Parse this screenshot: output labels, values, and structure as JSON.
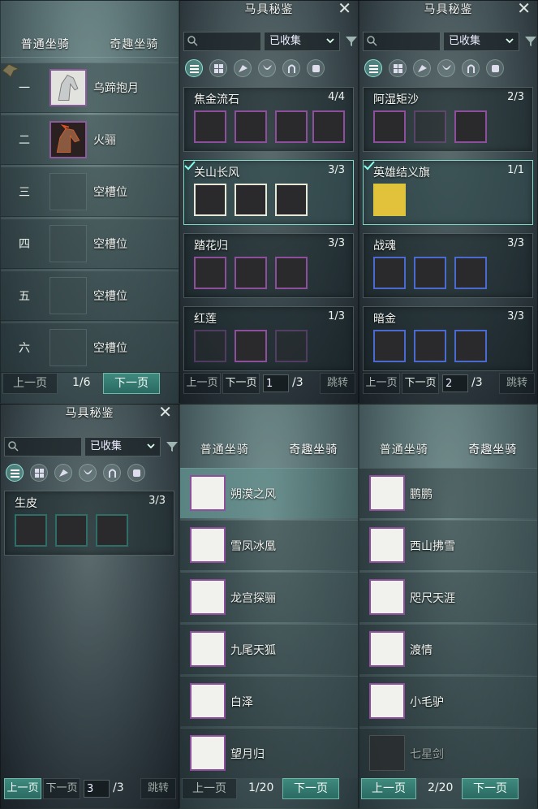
{
  "panel1": {
    "tabs": [
      "普通坐骑",
      "奇趣坐骑"
    ],
    "slots": [
      {
        "num": "一",
        "name": "乌蹄抱月"
      },
      {
        "num": "二",
        "name": "火骊"
      },
      {
        "num": "三",
        "name": "空槽位"
      },
      {
        "num": "四",
        "name": "空槽位"
      },
      {
        "num": "五",
        "name": "空槽位"
      },
      {
        "num": "六",
        "name": "空槽位"
      }
    ],
    "pager": {
      "prev": "上一页",
      "page": "1/6",
      "next": "下一页"
    }
  },
  "panel2": {
    "title": "马具秘鉴",
    "filter": "已收集",
    "cards": [
      {
        "name": "焦金流石",
        "count": "4/4"
      },
      {
        "name": "关山长风",
        "count": "3/3"
      },
      {
        "name": "踏花归",
        "count": "3/3"
      },
      {
        "name": "红莲",
        "count": "1/3"
      }
    ],
    "pager": {
      "prev": "上一页",
      "next": "下一页",
      "page_input": "1",
      "total": "/3",
      "jump": "跳转"
    }
  },
  "panel3": {
    "title": "马具秘鉴",
    "filter": "已收集",
    "cards": [
      {
        "name": "阿湿矩沙",
        "count": "2/3"
      },
      {
        "name": "英雄结义旗",
        "count": "1/1"
      },
      {
        "name": "战魂",
        "count": "3/3"
      },
      {
        "name": "暗金",
        "count": "3/3"
      }
    ],
    "pager": {
      "prev": "上一页",
      "next": "下一页",
      "page_input": "2",
      "total": "/3",
      "jump": "跳转"
    }
  },
  "panel4": {
    "title": "马具秘鉴",
    "filter": "已收集",
    "cards": [
      {
        "name": "生皮",
        "count": "3/3"
      }
    ],
    "pager": {
      "prev": "上一页",
      "next": "下一页",
      "page_input": "3",
      "total": "/3",
      "jump": "跳转"
    }
  },
  "panel5": {
    "tabs": [
      "普通坐骑",
      "奇趣坐骑"
    ],
    "mounts": [
      "朔漠之风",
      "雪凤冰凰",
      "龙宫探骊",
      "九尾天狐",
      "白泽",
      "望月归"
    ],
    "pager": {
      "prev": "上一页",
      "page": "1/20",
      "next": "下一页"
    }
  },
  "panel6": {
    "tabs": [
      "普通坐骑",
      "奇趣坐骑"
    ],
    "mounts": [
      "鹏鹏",
      "西山拂雪",
      "咫尺天涯",
      "渡情",
      "小毛驴",
      "七星剑"
    ],
    "pager": {
      "prev": "上一页",
      "page": "2/20",
      "next": "下一页"
    }
  },
  "colors": {
    "accent": "#3f8a7e",
    "rare_border": "#8d4f9c",
    "epic_border": "#4a6ad0"
  }
}
